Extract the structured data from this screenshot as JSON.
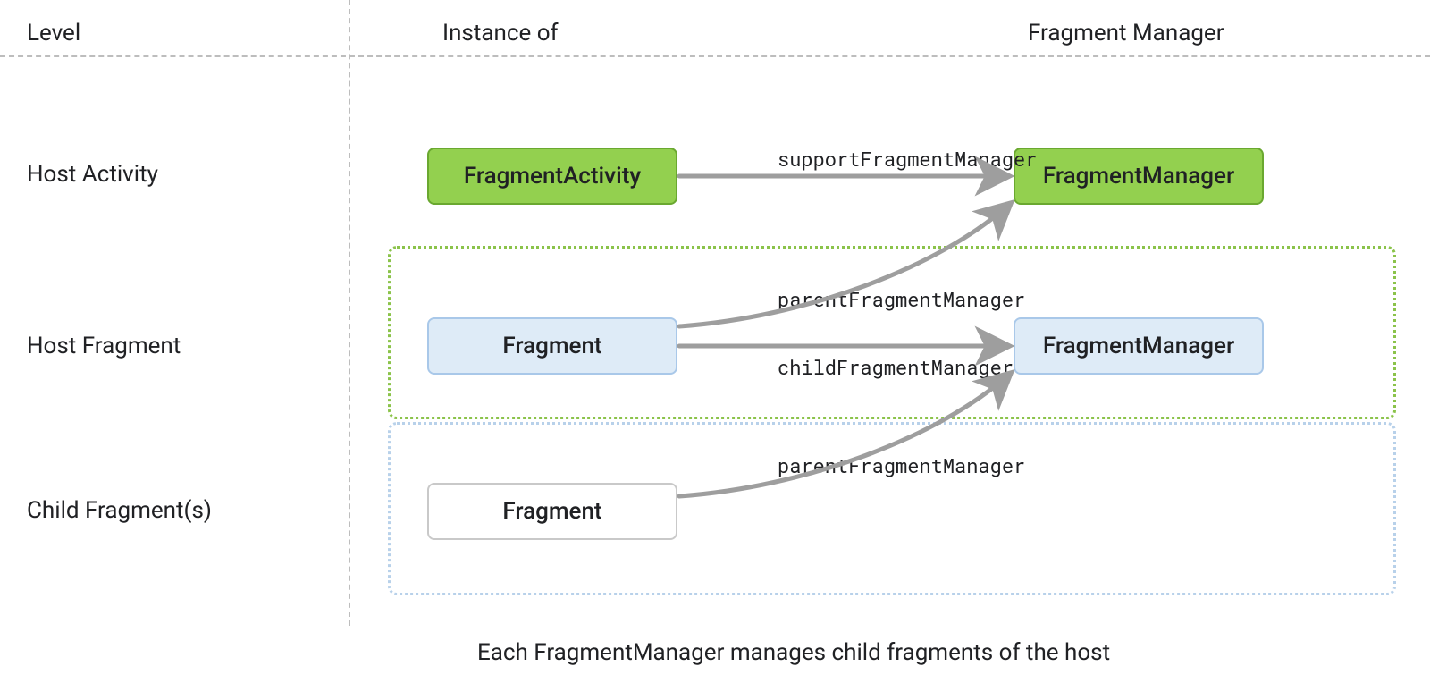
{
  "headers": {
    "level": "Level",
    "instance": "Instance of",
    "fragman": "Fragment Manager"
  },
  "rows": {
    "hostActivity": "Host Activity",
    "hostFragment": "Host Fragment",
    "childFragments": "Child Fragment(s)"
  },
  "nodes": {
    "activity": "FragmentActivity",
    "activityFM": "FragmentManager",
    "fragment": "Fragment",
    "fragmentFM": "FragmentManager",
    "childFragment": "Fragment"
  },
  "edges": {
    "supportFM": "supportFragmentManager",
    "parentFM1": "parentFragmentManager",
    "childFM": "childFragmentManager",
    "parentFM2": "parentFragmentManager"
  },
  "caption": "Each FragmentManager manages child fragments of the host"
}
